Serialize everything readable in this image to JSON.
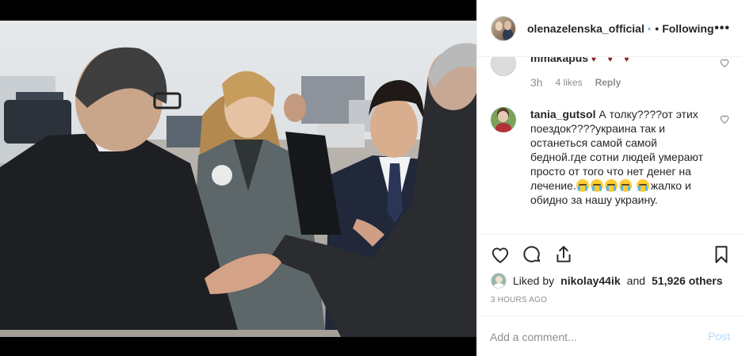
{
  "photo": {
    "description_icon": "post-photo"
  },
  "header": {
    "username": "olenazelenska_official",
    "verified_icon": "verified-badge-icon",
    "separator": "•",
    "follow_status": "Following",
    "more_label": "•••"
  },
  "comments": [
    {
      "username": "mmakapus",
      "text": "♥ ♥ ♥",
      "time": "3h",
      "likes": "4 likes",
      "reply": "Reply"
    },
    {
      "username": "tania_gutsol",
      "text_part1": "А толку????от этих поездок????украина так и останеться самой самой бедной.где сотни людей умерают просто от того что нет денег на лечение.",
      "text_part2": "жалко и обидно за нашу украину."
    }
  ],
  "likes": {
    "prefix": "Liked by",
    "user": "nikolay44ik",
    "conj": "and",
    "count": "51,926 others"
  },
  "timestamp": "3 HOURS AGO",
  "comment_form": {
    "placeholder": "Add a comment...",
    "post_label": "Post"
  },
  "colors": {
    "link": "#3897f0",
    "post_disabled": "#b3dbff",
    "meta": "#8e8e8e"
  }
}
